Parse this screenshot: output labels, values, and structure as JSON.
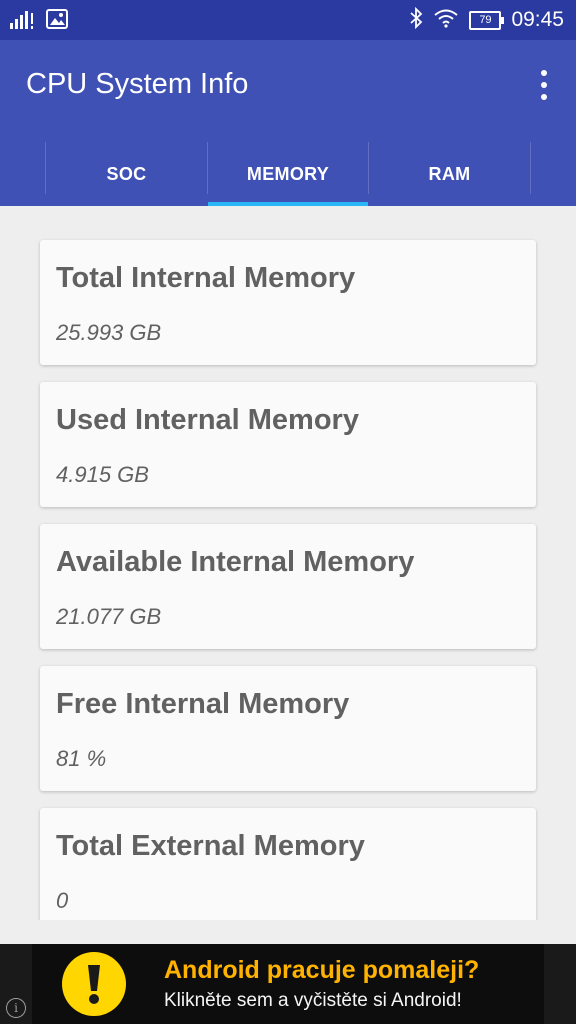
{
  "status_bar": {
    "battery": "79",
    "time": "09:45",
    "icons": [
      "signal-icon",
      "image-icon",
      "bluetooth-icon",
      "wifi-icon",
      "battery-icon"
    ]
  },
  "app_bar": {
    "title": "CPU System Info",
    "menu_icon": "overflow-menu-icon"
  },
  "tabs": [
    {
      "label": "SOC",
      "selected": false
    },
    {
      "label": "MEMORY",
      "selected": true
    },
    {
      "label": "RAM",
      "selected": false
    }
  ],
  "cards": [
    {
      "title": "Total Internal Memory",
      "value": "25.993 GB"
    },
    {
      "title": "Used Internal Memory",
      "value": "4.915 GB"
    },
    {
      "title": "Available Internal Memory",
      "value": "21.077 GB"
    },
    {
      "title": "Free Internal Memory",
      "value": "81 %"
    },
    {
      "title": "Total External Memory",
      "value": "0"
    }
  ],
  "ad": {
    "title": "Android pracuje pomaleji?",
    "subtitle": "Klikněte sem a vyčistěte si Android!",
    "icon": "warning-icon",
    "info_icon": "info-icon",
    "info_glyph": "i"
  },
  "colors": {
    "primary": "#3f51b5",
    "primary_dark": "#2b3aa0",
    "tab_indicator": "#29b6f6",
    "ad_title": "#ffb300",
    "ad_icon": "#ffd600"
  }
}
